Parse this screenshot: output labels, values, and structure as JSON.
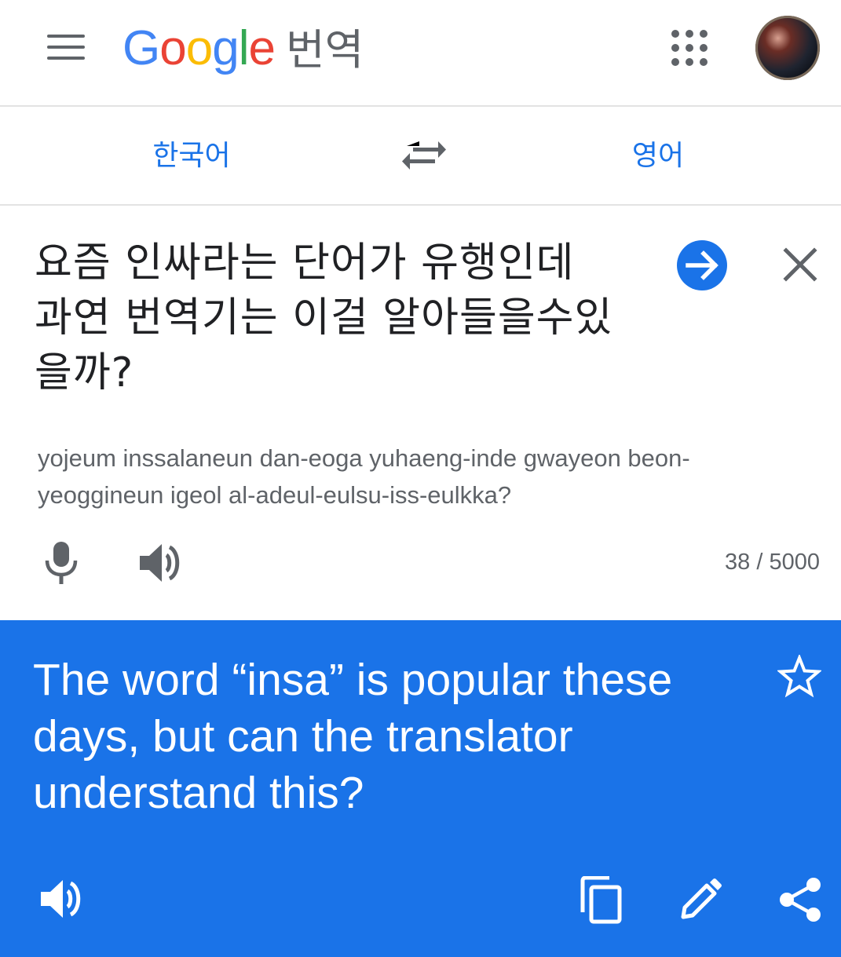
{
  "header": {
    "logo": {
      "letters": [
        {
          "char": "G",
          "color": "#4285F4"
        },
        {
          "char": "o",
          "color": "#EA4335"
        },
        {
          "char": "o",
          "color": "#FBBC05"
        },
        {
          "char": "g",
          "color": "#4285F4"
        },
        {
          "char": "l",
          "color": "#34A853"
        },
        {
          "char": "e",
          "color": "#EA4335"
        }
      ],
      "suffix": "번역"
    },
    "menu_icon": "hamburger-menu-icon",
    "apps_icon": "apps-grid-icon",
    "avatar_icon": "profile-avatar"
  },
  "languages": {
    "source": "한국어",
    "target": "영어",
    "swap_icon": "swap-arrows-icon"
  },
  "source": {
    "text": "요즘 인싸라는 단어가 유행인데 과연 번역기는 이걸 알아들을수있을까?",
    "text_lines": [
      "요즘 인싸라는 단어가 유행인데",
      "과연 번역기는 이걸 알아들을수있",
      "을까?"
    ],
    "romanization": "yojeum inssalaneun dan-eoga yuhaeng-inde gwayeon beon-yeoggineun igeol al-adeul-eulsu-iss-eulkka?",
    "romanization_lines": [
      "yojeum inssalaneun dan-eoga yuhaeng-inde gwayeon beon-",
      "yeoggineun igeol al-adeul-eulsu-iss-eulkka?"
    ],
    "char_count": "38 / 5000"
  },
  "result": {
    "text": "The word “insa” is popular these days, but can the translator understand this?",
    "text_lines": [
      "The word “insa” is popular these",
      "days, but can the translator",
      "understand this?"
    ]
  },
  "colors": {
    "accent": "#1a73e8",
    "icon_gray": "#5f6368",
    "text_dark": "#202124",
    "divider": "#e3e3e3"
  }
}
